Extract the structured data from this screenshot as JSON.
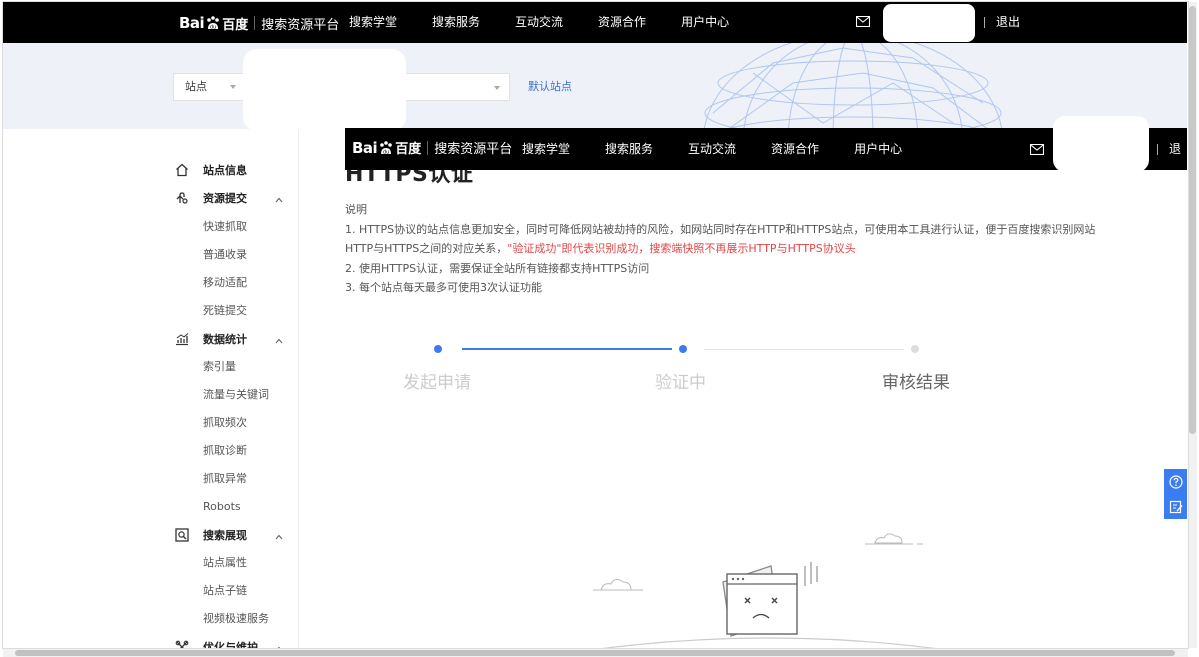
{
  "brand": {
    "logo_text": "Bai",
    "logo_cn": "百度",
    "platform": "搜索资源平台"
  },
  "nav": {
    "items": [
      {
        "label": "搜索学堂"
      },
      {
        "label": "搜索服务"
      },
      {
        "label": "互动交流"
      },
      {
        "label": "资源合作"
      },
      {
        "label": "用户中心"
      }
    ],
    "logout": "退出"
  },
  "site_bar": {
    "select_label": "站点",
    "default_site": "默认站点"
  },
  "sidebar": {
    "groups": [
      {
        "label": "站点信息",
        "icon": "home-icon",
        "items": []
      },
      {
        "label": "资源提交",
        "icon": "submit-icon",
        "items": [
          {
            "label": "快速抓取"
          },
          {
            "label": "普通收录"
          },
          {
            "label": "移动适配"
          },
          {
            "label": "死链提交"
          }
        ]
      },
      {
        "label": "数据统计",
        "icon": "chart-icon",
        "items": [
          {
            "label": "索引量"
          },
          {
            "label": "流量与关键词"
          },
          {
            "label": "抓取频次"
          },
          {
            "label": "抓取诊断"
          },
          {
            "label": "抓取异常"
          },
          {
            "label": "Robots"
          }
        ]
      },
      {
        "label": "搜索展现",
        "icon": "search-display-icon",
        "items": [
          {
            "label": "站点属性"
          },
          {
            "label": "站点子链"
          },
          {
            "label": "视频极速服务"
          }
        ]
      },
      {
        "label": "优化与维护",
        "icon": "tools-icon",
        "items": []
      }
    ]
  },
  "content": {
    "title": "HTTPS认证",
    "desc_label": "说明",
    "desc_1a": "1. HTTPS协议的站点信息更加安全，同时可降低网站被劫持的风险，如网站同时存在HTTP和HTTPS站点，可使用本工具进行认证，便于百度搜索识别网站",
    "desc_1b": "HTTP与HTTPS之间的对应关系，",
    "desc_1c": "\"验证成功\"即代表识别成功，搜索端快照不再展示HTTP与HTTPS协议头",
    "desc_2": "2. 使用HTTPS认证，需要保证全站所有链接都支持HTTPS访问",
    "desc_3": "3. 每个站点每天最多可使用3次认证功能",
    "steps": [
      {
        "label": "发起申请"
      },
      {
        "label": "验证中"
      },
      {
        "label": "审核结果"
      }
    ]
  },
  "colors": {
    "accent": "#3b7cf0",
    "highlight_red": "#e54545",
    "nav_bg": "#000000",
    "banner_bg": "#eef1f7"
  }
}
